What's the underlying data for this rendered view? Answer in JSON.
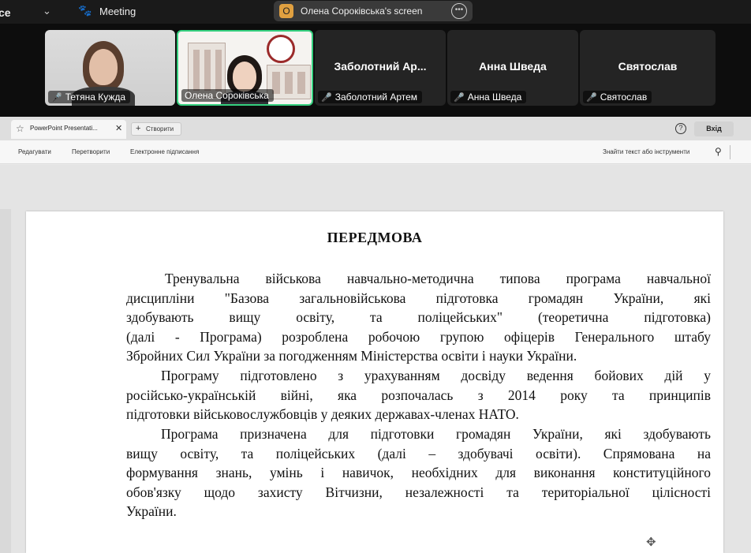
{
  "zoom": {
    "app_name_partial": "ce",
    "meeting_label": "Meeting",
    "share_label": "Олена Сороківська's screen",
    "share_avatar_letter": "О",
    "participants": [
      {
        "name": "Тетяна Кужда",
        "muted": true,
        "video": true
      },
      {
        "name": "Олена Сороківська",
        "muted": false,
        "video": true,
        "active_speaker": true
      },
      {
        "display_name": "Заболотний  Ар...",
        "name": "Заболотний Артем",
        "muted": true,
        "video": false
      },
      {
        "display_name": "Анна Шведа",
        "name": "Анна Шведа",
        "muted": true,
        "video": false
      },
      {
        "display_name": "Святослав",
        "name": "Святослав",
        "muted": true,
        "video": false
      }
    ]
  },
  "browser": {
    "tab_label": "PowerPoint Presentati...",
    "new_tab_label": "Створити",
    "login_label": "Вхід",
    "toolbar": {
      "edit_label": "Редагувати",
      "convert_label": "Перетворити",
      "sign_label": "Електронне підписання",
      "search_placeholder": "Знайти текст або інструменти"
    }
  },
  "document": {
    "title": "ПЕРЕДМОВА",
    "paragraphs": [
      [
        "Тренувальна військова навчально-методична типова програма навчальної",
        "дисципліни \"Базова загальновійськова підготовка громадян України, які",
        "здобувають вищу освіту, та поліцейських\" (теоретична підготовка)",
        "(далі - Програма) розроблена робочою групою офіцерів Генерального штабу",
        "Збройних Сил України за погодженням Міністерства освіти і науки України."
      ],
      [
        "Програму підготовлено з урахуванням досвіду ведення бойових дій у",
        "російсько-українській війні, яка розпочалась з 2014 року та принципів",
        "підготовки військовослужбовців у деяких державах-членах НАТО."
      ],
      [
        "Програма призначена для підготовки громадян України, які здобувають",
        "вищу освіту, та поліцейських (далі – здобувачі освіти). Спрямована на",
        "формування знань, умінь і навичок, необхідних для виконання конституційного",
        "обов'язку щодо захисту Вітчизни, незалежності та територіальної цілісності",
        "України."
      ]
    ]
  },
  "colors": {
    "active_speaker": "#35d07f",
    "muted_mic": "#e5484d",
    "emblem": "#9b2a2a"
  },
  "icons": [
    "chevron-down-icon",
    "paw-icon",
    "more-icon",
    "mic-muted-icon",
    "star-icon",
    "close-icon",
    "plus-icon",
    "help-icon",
    "search-icon",
    "move-icon"
  ]
}
